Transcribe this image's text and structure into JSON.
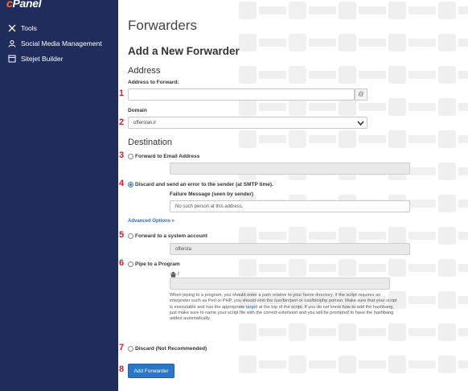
{
  "sidebar": {
    "logo_c": "c",
    "logo_rest": "Panel",
    "items": [
      {
        "label": "Tools",
        "icon": "tools-icon"
      },
      {
        "label": "Social Media Management",
        "icon": "social-media-icon"
      },
      {
        "label": "Sitejet Builder",
        "icon": "sitejet-icon"
      }
    ]
  },
  "page": {
    "title": "Forwarders",
    "section_title": "Add a New Forwarder"
  },
  "address": {
    "heading": "Address",
    "forward_label": "Address to Forward:",
    "forward_value": "",
    "at_symbol": "@",
    "domain_label": "Domain",
    "domain_value": "offerstan.ir"
  },
  "destination": {
    "heading": "Destination",
    "forward_email_label": "Forward to Email Address",
    "forward_email_value": "",
    "discard_error_label": "Discard and send an error to the sender (at SMTP time).",
    "failure_message_label": "Failure Message (seen by sender)",
    "failure_message_value": "No such person at this address.",
    "advanced_options": "Advanced Options »",
    "system_account_label": "Forward to a system account",
    "system_account_value": "offersta",
    "pipe_label": "Pipe to a Program",
    "pipe_prefix": "/",
    "pipe_value": "",
    "pipe_help_1": "When piping to a program, you should enter a path relative to your home directory. If the script requires an interpreter such as Perl or PHP, you should omit the /usr/bin/perl or /usr/bin/php portion. Make sure that your script is executable and has the appropriate",
    "pipe_help_link": "target",
    "pipe_help_2": "at the top of the script. If you do not know how to add the hashbang, just make sure to name your script file with the correct extension and you will be prompted to have the hashbang added automatically.",
    "discard_label": "Discard (Not Recommended)",
    "selected_option": "discard_error"
  },
  "submit_label": "Add Forwarder",
  "markers": [
    "1",
    "2",
    "3",
    "4",
    "5",
    "6",
    "7",
    "8"
  ],
  "colors": {
    "sidebar_bg": "#1f2c5c",
    "primary": "#2a77c9",
    "marker": "#d81b2c",
    "link": "#2a6cc0"
  }
}
